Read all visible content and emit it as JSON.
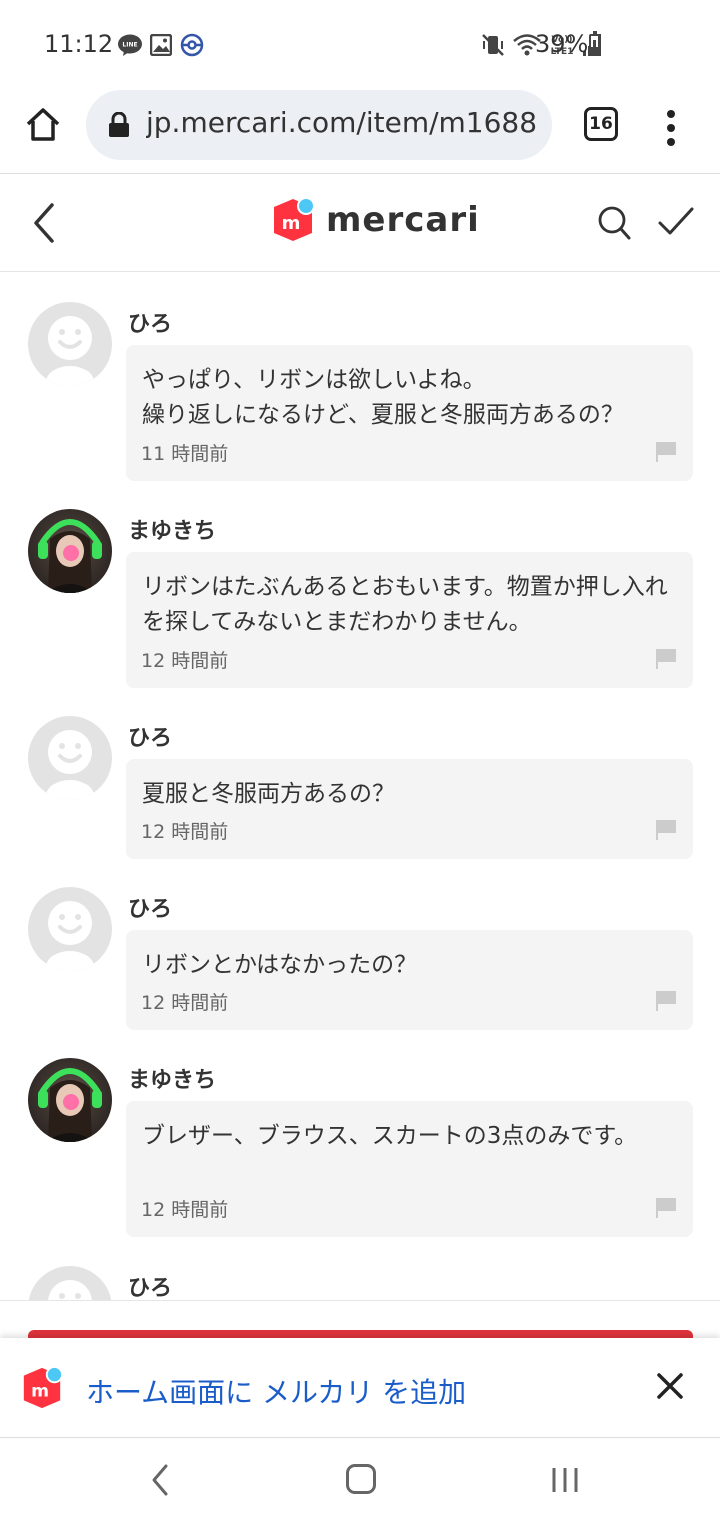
{
  "status_bar": {
    "time": "11:12",
    "battery": "39%",
    "battery_level": 0.39,
    "line_badge": "LINE",
    "volte_label": "Vo)) LTE1"
  },
  "browser": {
    "url": "jp.mercari.com/item/m1688",
    "tab_count": "16"
  },
  "header": {
    "logo_text": "mercari",
    "brand_color": "#ff333f",
    "accent_dot_color": "#4dc8f4"
  },
  "comments": [
    {
      "user": "ひろ",
      "avatar": "default",
      "text": "やっぱり、リボンは欲しいよね。\n繰り返しになるけど、夏服と冬服両方あるの？",
      "time": "11 時間前"
    },
    {
      "user": "まゆきち",
      "avatar": "photo",
      "text": "リボンはたぶんあるとおもいます。物置か押し入れを探してみないとまだわかりません。",
      "time": "12 時間前"
    },
    {
      "user": "ひろ",
      "avatar": "default",
      "text": "夏服と冬服両方あるの？",
      "time": "12 時間前"
    },
    {
      "user": "ひろ",
      "avatar": "default",
      "text": "リボンとかはなかったの？",
      "time": "12 時間前"
    },
    {
      "user": "まゆきち",
      "avatar": "photo",
      "text": "ブレザー、ブラウス、スカートの3点のみです。",
      "time": "12 時間前"
    },
    {
      "user": "ひろ",
      "avatar": "default"
    }
  ],
  "add_to_home": {
    "text": "ホーム画面に メルカリ を追加"
  }
}
